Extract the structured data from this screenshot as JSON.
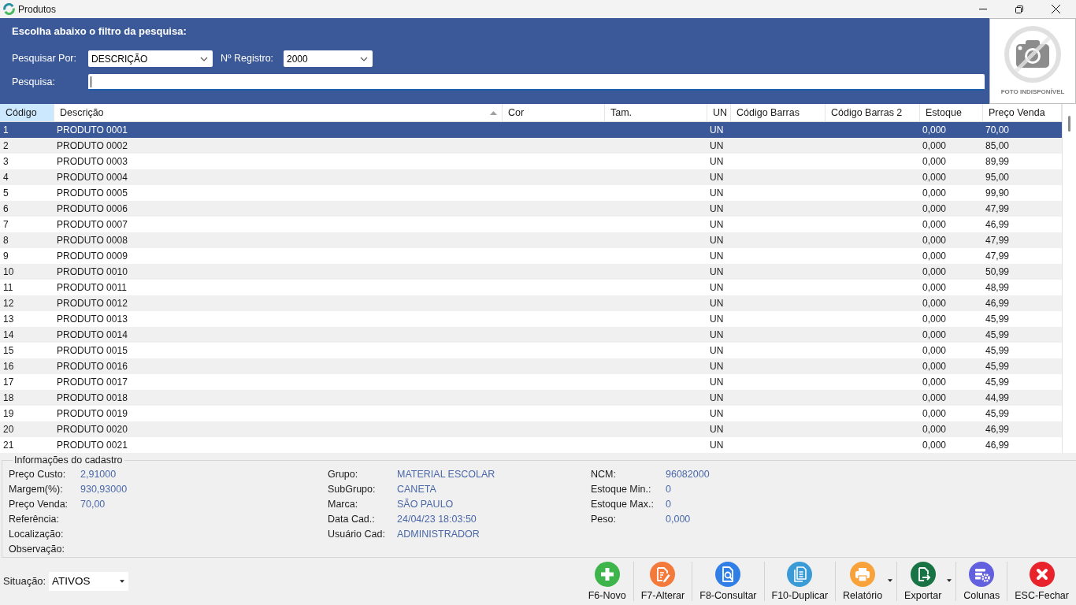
{
  "window": {
    "title": "Produtos"
  },
  "filter_panel": {
    "heading": "Escolha abaixo o filtro da pesquisa:",
    "search_by": {
      "label": "Pesquisar Por:",
      "value": "DESCRIÇÃO"
    },
    "record_limit": {
      "label": "Nº Registro:",
      "value": "2000"
    },
    "search": {
      "label": "Pesquisa:",
      "focused": true
    }
  },
  "photo": {
    "caption": "FOTO INDISPONÍVEL"
  },
  "table": {
    "columns": [
      {
        "label": "Código",
        "selected": true,
        "sorted": false
      },
      {
        "label": "Descrição",
        "selected": false,
        "sorted": true
      },
      {
        "label": "Cor",
        "selected": false,
        "sorted": false
      },
      {
        "label": "Tam.",
        "selected": false,
        "sorted": false
      },
      {
        "label": "UN",
        "selected": false,
        "sorted": false
      },
      {
        "label": "Código Barras",
        "selected": false,
        "sorted": false
      },
      {
        "label": "Código Barras 2",
        "selected": false,
        "sorted": false
      },
      {
        "label": "Estoque",
        "selected": false,
        "sorted": false
      },
      {
        "label": "Preço Venda",
        "selected": false,
        "sorted": false
      }
    ],
    "rows": [
      {
        "code": "1",
        "description": "PRODUTO 0001",
        "unit": "UN",
        "stock": "0,000",
        "price": "70,00",
        "selected": true
      },
      {
        "code": "2",
        "description": "PRODUTO 0002",
        "unit": "UN",
        "stock": "0,000",
        "price": "85,00",
        "selected": false
      },
      {
        "code": "3",
        "description": "PRODUTO 0003",
        "unit": "UN",
        "stock": "0,000",
        "price": "89,99",
        "selected": false
      },
      {
        "code": "4",
        "description": "PRODUTO 0004",
        "unit": "UN",
        "stock": "0,000",
        "price": "95,00",
        "selected": false
      },
      {
        "code": "5",
        "description": "PRODUTO 0005",
        "unit": "UN",
        "stock": "0,000",
        "price": "99,90",
        "selected": false
      },
      {
        "code": "6",
        "description": "PRODUTO 0006",
        "unit": "UN",
        "stock": "0,000",
        "price": "47,99",
        "selected": false
      },
      {
        "code": "7",
        "description": "PRODUTO 0007",
        "unit": "UN",
        "stock": "0,000",
        "price": "46,99",
        "selected": false
      },
      {
        "code": "8",
        "description": "PRODUTO 0008",
        "unit": "UN",
        "stock": "0,000",
        "price": "47,99",
        "selected": false
      },
      {
        "code": "9",
        "description": "PRODUTO 0009",
        "unit": "UN",
        "stock": "0,000",
        "price": "47,99",
        "selected": false
      },
      {
        "code": "10",
        "description": "PRODUTO 0010",
        "unit": "UN",
        "stock": "0,000",
        "price": "50,99",
        "selected": false
      },
      {
        "code": "11",
        "description": "PRODUTO 0011",
        "unit": "UN",
        "stock": "0,000",
        "price": "48,99",
        "selected": false
      },
      {
        "code": "12",
        "description": "PRODUTO 0012",
        "unit": "UN",
        "stock": "0,000",
        "price": "46,99",
        "selected": false
      },
      {
        "code": "13",
        "description": "PRODUTO 0013",
        "unit": "UN",
        "stock": "0,000",
        "price": "45,99",
        "selected": false
      },
      {
        "code": "14",
        "description": "PRODUTO 0014",
        "unit": "UN",
        "stock": "0,000",
        "price": "45,99",
        "selected": false
      },
      {
        "code": "15",
        "description": "PRODUTO 0015",
        "unit": "UN",
        "stock": "0,000",
        "price": "45,99",
        "selected": false
      },
      {
        "code": "16",
        "description": "PRODUTO 0016",
        "unit": "UN",
        "stock": "0,000",
        "price": "45,99",
        "selected": false
      },
      {
        "code": "17",
        "description": "PRODUTO 0017",
        "unit": "UN",
        "stock": "0,000",
        "price": "45,99",
        "selected": false
      },
      {
        "code": "18",
        "description": "PRODUTO 0018",
        "unit": "UN",
        "stock": "0,000",
        "price": "44,99",
        "selected": false
      },
      {
        "code": "19",
        "description": "PRODUTO 0019",
        "unit": "UN",
        "stock": "0,000",
        "price": "45,99",
        "selected": false
      },
      {
        "code": "20",
        "description": "PRODUTO 0020",
        "unit": "UN",
        "stock": "0,000",
        "price": "46,99",
        "selected": false
      },
      {
        "code": "21",
        "description": "PRODUTO 0021",
        "unit": "UN",
        "stock": "0,000",
        "price": "46,99",
        "selected": false
      }
    ]
  },
  "info_panel": {
    "title": "Informações do cadastro",
    "columns": [
      {
        "fields": [
          {
            "label": "Preço Custo:",
            "value": "2,91000"
          },
          {
            "label": "Margem(%):",
            "value": "930,93000"
          },
          {
            "label": "Preço Venda:",
            "value": "70,00"
          },
          {
            "label": "Referência:"
          },
          {
            "label": "Localização:"
          },
          {
            "label": "Observação:"
          }
        ]
      },
      {
        "fields": [
          {
            "label": "Grupo:",
            "value": "MATERIAL ESCOLAR"
          },
          {
            "label": "SubGrupo:",
            "value": "CANETA"
          },
          {
            "label": "Marca:",
            "value": "SÃO PAULO"
          },
          {
            "label": "Data Cad.:",
            "value": "24/04/23 18:03:50"
          },
          {
            "label": "Usuário Cad:",
            "value": "ADMINISTRADOR"
          }
        ]
      },
      {
        "fields": [
          {
            "label": "NCM:",
            "value": "96082000"
          },
          {
            "label": "Estoque Min.:",
            "value": "0"
          },
          {
            "label": "Estoque Max.:",
            "value": "0"
          },
          {
            "label": "Peso:",
            "value": "0,000"
          }
        ]
      }
    ]
  },
  "footer": {
    "status_filter": {
      "label": "Situação:",
      "value": "ATIVOS"
    },
    "buttons": [
      {
        "label": "F6-Novo",
        "kind": "add",
        "dropdown": false
      },
      {
        "label": "F7-Alterar",
        "kind": "edit",
        "dropdown": false
      },
      {
        "label": "F8-Consultar",
        "kind": "view",
        "dropdown": false
      },
      {
        "label": "F10-Duplicar",
        "kind": "duplicate",
        "dropdown": false
      },
      {
        "label": "Relatório",
        "kind": "print",
        "dropdown": true
      },
      {
        "label": "Exportar",
        "kind": "export",
        "dropdown": true
      },
      {
        "label": "Colunas",
        "kind": "columns",
        "dropdown": false
      },
      {
        "label": "ESC-Fechar",
        "kind": "close",
        "dropdown": false
      }
    ]
  }
}
